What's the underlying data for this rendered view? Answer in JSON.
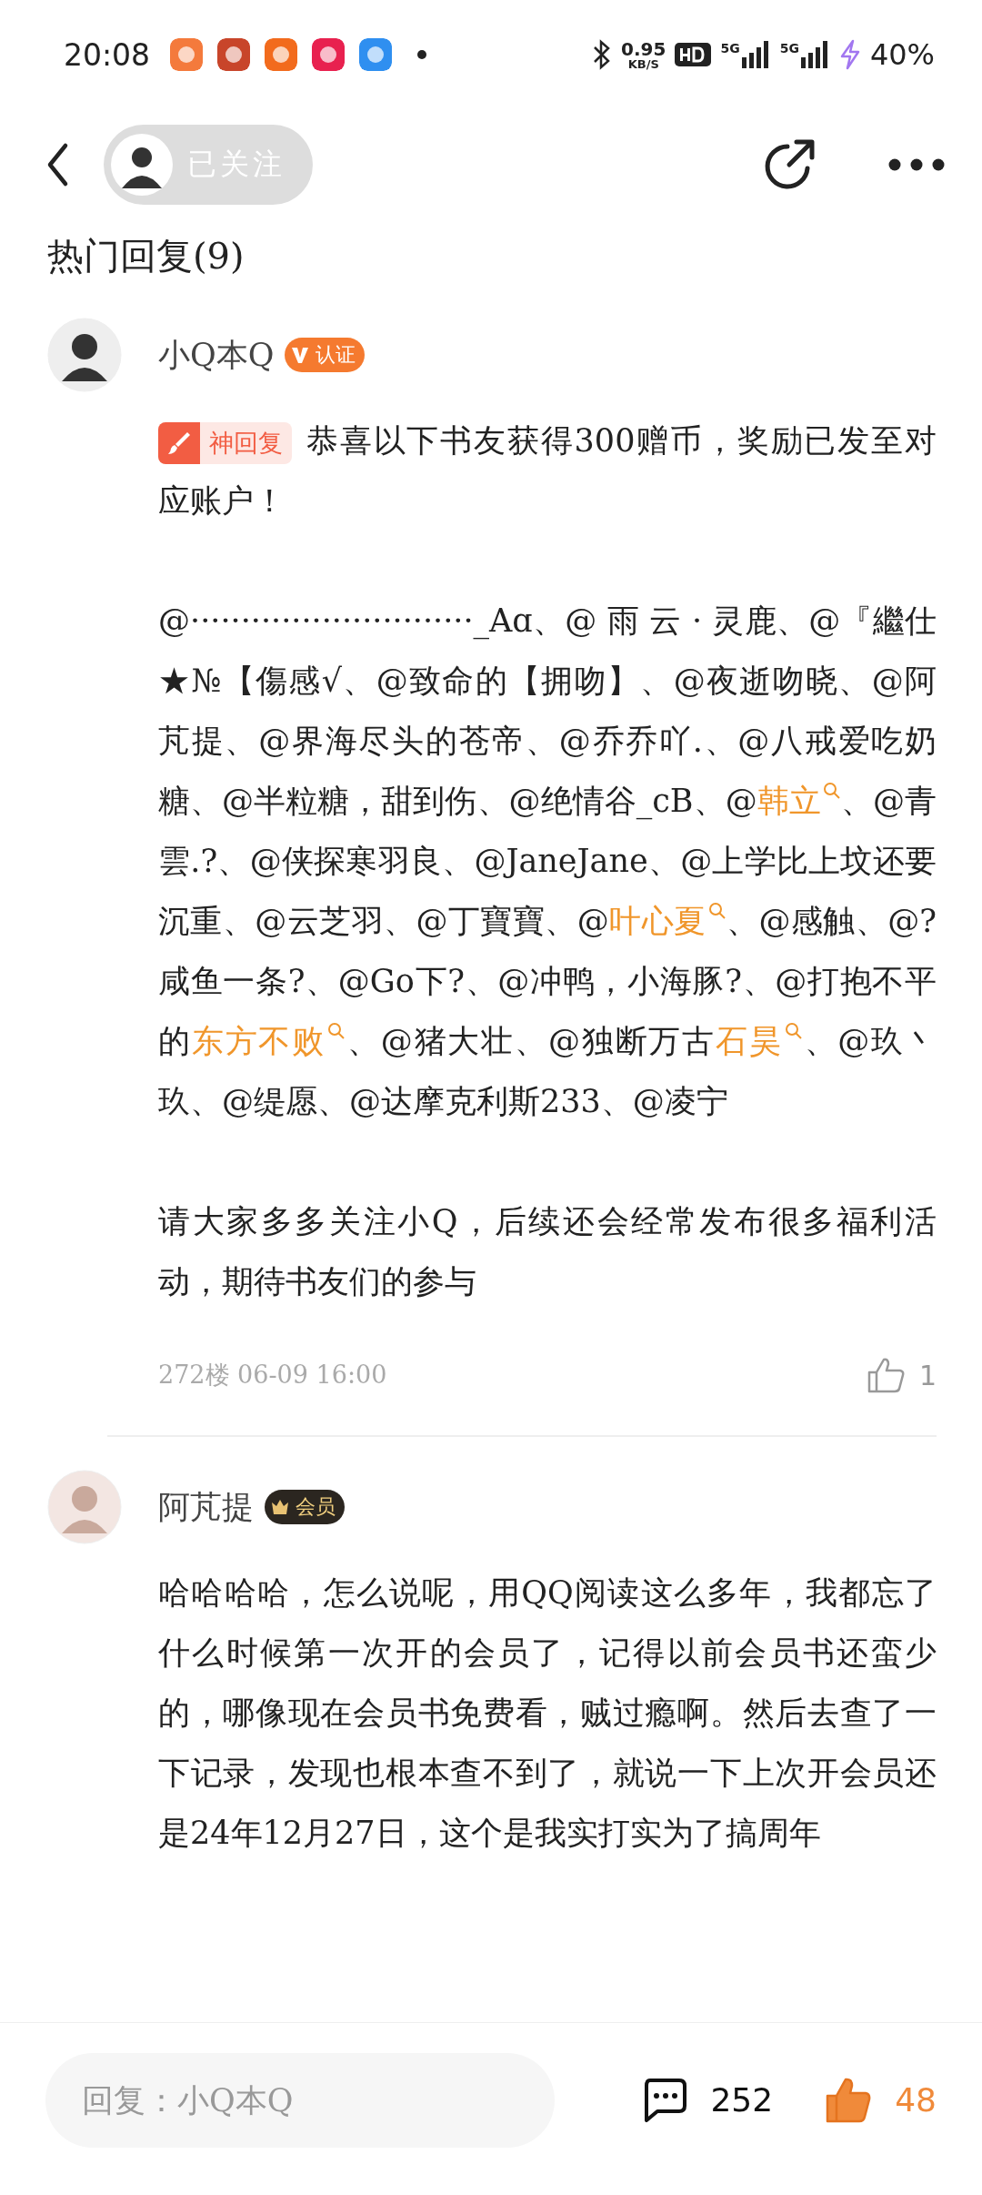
{
  "status_bar": {
    "time": "20:08",
    "speed": "0.95",
    "speed_unit": "KB/S",
    "network_types": [
      "5G",
      "5G"
    ],
    "battery": "40%"
  },
  "header": {
    "follow_button": "已关注"
  },
  "section_title": "热门回复(9)",
  "comments": [
    {
      "author": "小Q本Q",
      "badge": {
        "kind": "verified",
        "label": "认证"
      },
      "tag": "神回复",
      "paragraphs": [
        [
          {
            "kind": "text",
            "text": "恭喜以下书友获得300赠币，奖励已发至对应账户！"
          }
        ],
        [
          {
            "kind": "text",
            "text": "@····························_Aɑ、@ 雨 云 · 灵鹿、@『繼仕★№【傷感√、@致命的【拥吻】、@夜逝吻晓、@阿芃提、@界海尽头的苍帝、@乔乔吖.、@八戒爱吃奶糖、@半粒糖，甜到伤、@绝情谷_cB、@"
          },
          {
            "kind": "mention",
            "text": "韩立"
          },
          {
            "kind": "text",
            "text": "、@青雲.?、@侠探寒羽良、@JaneJane、@上学比上坟还要沉重、@云芝羽、@丁寶寶、@"
          },
          {
            "kind": "mention",
            "text": "叶心夏"
          },
          {
            "kind": "text",
            "text": "、@感触、@?咸鱼一条?、@Go下?、@冲鸭，小海豚?、@打抱不平的"
          },
          {
            "kind": "mention",
            "text": "东方不败"
          },
          {
            "kind": "text",
            "text": "、@猪大壮、@独断万古"
          },
          {
            "kind": "mention",
            "text": "石昊"
          },
          {
            "kind": "text",
            "text": "、@玖丶玖、@缇愿、@达摩克利斯233、@凌宁"
          }
        ],
        [
          {
            "kind": "text",
            "text": "请大家多多关注小Q，后续还会经常发布很多福利活动，期待书友们的参与"
          }
        ]
      ],
      "meta": "272楼 06-09 16:00",
      "likes": "1"
    },
    {
      "author": "阿芃提",
      "badge": {
        "kind": "member",
        "label": "会员"
      },
      "paragraphs": [
        [
          {
            "kind": "text",
            "text": "哈哈哈哈，怎么说呢，用QQ阅读这么多年，我都忘了什么时候第一次开的会员了，记得以前会员书还蛮少的，哪像现在会员书免费看，贼过瘾啊。然后去查了一下记录，发现也根本查不到了，就说一下上次开会员还是24年12月27日，这个是我实打实为了搞周年"
          }
        ]
      ]
    }
  ],
  "reply_bar": {
    "placeholder": "回复：小Q本Q",
    "comment_count": "252",
    "like_count": "48",
    "liked": true
  }
}
